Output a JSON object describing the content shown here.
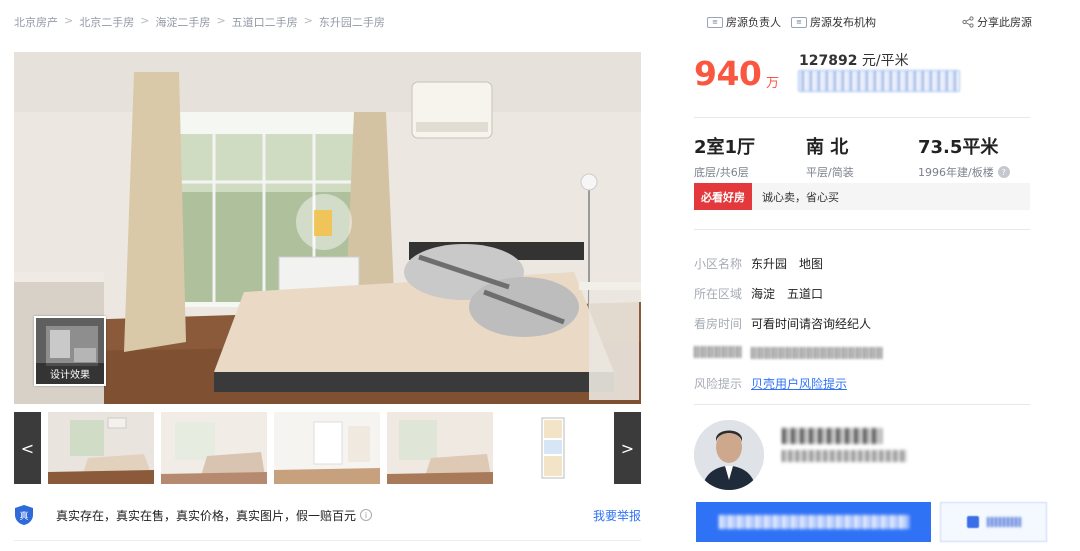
{
  "breadcrumb": [
    "北京房产",
    "北京二手房",
    "海淀二手房",
    "五道口二手房",
    "东升园二手房"
  ],
  "breadcrumb_separator": ">",
  "gallery": {
    "design_label": "设计效果",
    "prev_arrow": "<",
    "next_arrow": ">"
  },
  "guarantee": {
    "badge": "真",
    "text": "真实存在，真实在售，真实价格，真实图片，假一赔百元",
    "info_icon": "i",
    "report": "我要举报"
  },
  "top_actions": {
    "owner": "房源负责人",
    "agency": "房源发布机构",
    "share": "分享此房源"
  },
  "price": {
    "total": "940",
    "total_unit": "万",
    "unit_price_value": "127892",
    "unit_price_unit": " 元/平米"
  },
  "specs": [
    {
      "main": "2室1厅",
      "sub": "底层/共6层"
    },
    {
      "main": "南 北",
      "sub": "平层/简装"
    },
    {
      "main": "73.5平米",
      "sub": "1996年建/板楼"
    }
  ],
  "help_icon": "?",
  "tag": {
    "label": "必看好房",
    "text": "诚心卖，省心买"
  },
  "info": {
    "community_label": "小区名称",
    "community_name": "东升园",
    "community_map": "地图",
    "area_label": "所在区域",
    "area_district": "海淀",
    "area_block": "五道口",
    "visit_label": "看房时间",
    "visit_value": "可看时间请咨询经纪人",
    "risk_label": "风险提示",
    "risk_link": "贝壳用户风险提示"
  },
  "icons": {
    "owner": "owner-card-icon",
    "agency": "agency-card-icon",
    "share": "share-icon",
    "shield": "shield-icon"
  },
  "colors": {
    "price": "#fa5741",
    "accent": "#3072f6",
    "tag": "#e4393c"
  }
}
